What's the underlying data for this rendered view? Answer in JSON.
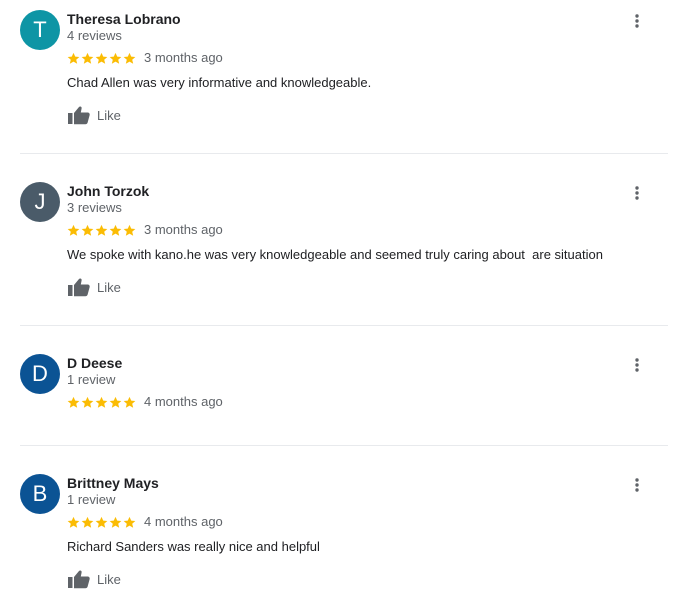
{
  "colors": {
    "star": "#fbbc04",
    "avatar_teal": "#0e95a5",
    "avatar_slate": "#4a5b69",
    "avatar_blue": "#0b5394",
    "secondary_text": "#5f6368",
    "divider": "#e8eaed"
  },
  "like_label": "Like",
  "reviews": [
    {
      "initial": "T",
      "name": "Theresa Lobrano",
      "count": "4 reviews",
      "stars": 5,
      "date": "3 months ago",
      "text": "Chad Allen was very informative and knowledgeable."
    },
    {
      "initial": "J",
      "name": "John Torzok",
      "count": "3 reviews",
      "stars": 5,
      "date": "3 months ago",
      "text": "We spoke with kano.he was very knowledgeable and seemed truly caring about  are situation"
    },
    {
      "initial": "D",
      "name": "D Deese",
      "count": "1 review",
      "stars": 5,
      "date": "4 months ago",
      "text": ""
    },
    {
      "initial": "B",
      "name": "Brittney Mays",
      "count": "1 review",
      "stars": 5,
      "date": "4 months ago",
      "text": "Richard Sanders was really nice and helpful"
    }
  ]
}
